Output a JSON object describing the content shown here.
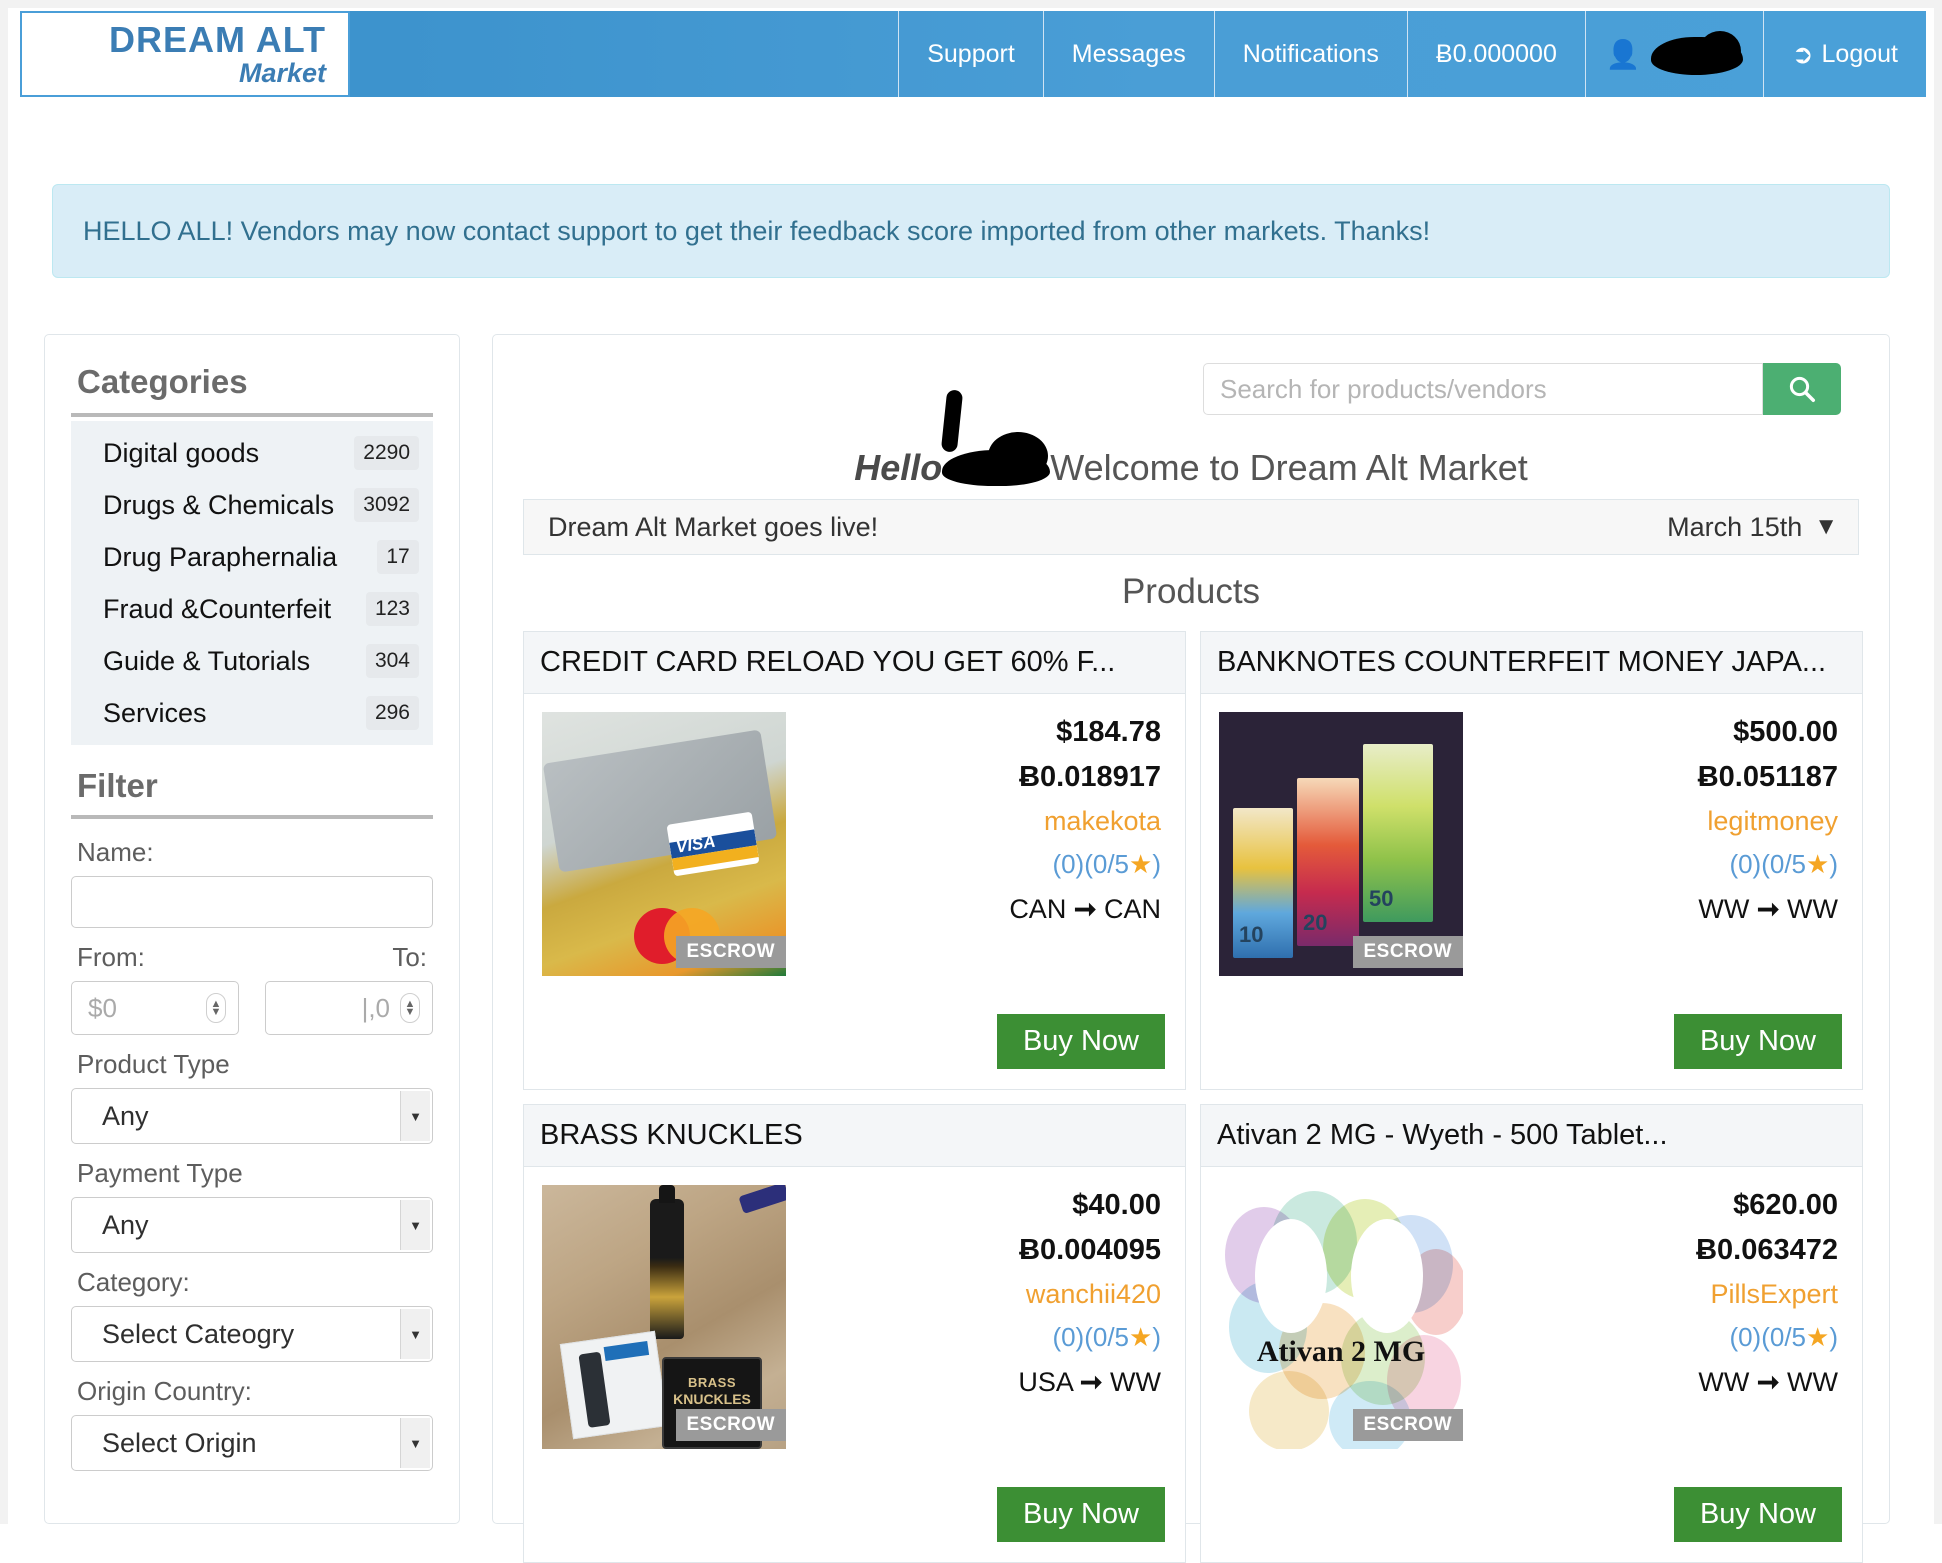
{
  "navbar": {
    "brand_line1": "DREAM ALT",
    "brand_line2": "Market",
    "items": [
      {
        "label": "Support"
      },
      {
        "label": "Messages"
      },
      {
        "label": "Notifications"
      },
      {
        "label": "Ƀ0.000000"
      }
    ],
    "username_redacted": "",
    "logout_label": "Logout"
  },
  "alert": {
    "message": "HELLO ALL! Vendors may now contact support to get their feedback score imported from other markets. Thanks!"
  },
  "sidebar": {
    "categories_title": "Categories",
    "categories": [
      {
        "name": "Digital goods",
        "count": "2290"
      },
      {
        "name": "Drugs & Chemicals",
        "count": "3092"
      },
      {
        "name": "Drug Paraphernalia",
        "count": "17"
      },
      {
        "name": "Fraud &Counterfeit",
        "count": "123"
      },
      {
        "name": "Guide & Tutorials",
        "count": "304"
      },
      {
        "name": "Services",
        "count": "296"
      }
    ],
    "filter_title": "Filter",
    "name_label": "Name:",
    "name_value": "",
    "from_label": "From:",
    "to_label": "To:",
    "from_placeholder": "$0",
    "to_placeholder": "|,0",
    "product_type_label": "Product Type",
    "product_type_value": "Any",
    "payment_type_label": "Payment Type",
    "payment_type_value": "Any",
    "category_label": "Category:",
    "category_value": "Select Cateogry",
    "origin_label": "Origin Country:",
    "origin_value": "Select Origin"
  },
  "main": {
    "search_placeholder": "Search for products/vendors",
    "search_value": "",
    "welcome_prefix": "Hello",
    "welcome_suffix": "Welcome to Dream Alt Market",
    "announcement_text": "Dream Alt Market goes live!",
    "announcement_date": "March 15th",
    "products_title": "Products",
    "buy_label": "Buy Now",
    "escrow_label": "ESCROW",
    "products": [
      {
        "title": "CREDIT CARD RELOAD YOU GET 60% F...",
        "price_usd": "$184.78",
        "price_btc": "Ƀ0.018917",
        "vendor": "makekota",
        "rating": "(0)(0/5",
        "rating_close": ")",
        "ship_from": "CAN",
        "ship_to": "CAN",
        "art": "credit-card"
      },
      {
        "title": "BANKNOTES COUNTERFEIT MONEY JAPA...",
        "price_usd": "$500.00",
        "price_btc": "Ƀ0.051187",
        "vendor": "legitmoney",
        "rating": "(0)(0/5",
        "rating_close": ")",
        "ship_from": "WW",
        "ship_to": "WW",
        "art": "banknotes"
      },
      {
        "title": "BRASS KNUCKLES",
        "price_usd": "$40.00",
        "price_btc": "Ƀ0.004095",
        "vendor": "wanchii420",
        "rating": "(0)(0/5",
        "rating_close": ")",
        "ship_from": "USA",
        "ship_to": "WW",
        "art": "brass-knuckles"
      },
      {
        "title": "Ativan 2 MG - Wyeth - 500 Tablet...",
        "price_usd": "$620.00",
        "price_btc": "Ƀ0.063472",
        "vendor": "PillsExpert",
        "rating": "(0)(0/5",
        "rating_close": ")",
        "ship_from": "WW",
        "ship_to": "WW",
        "art": "ativan",
        "art_label": "Ativan 2 MG"
      }
    ]
  },
  "colors": {
    "nav_blue": "#4a9ed6",
    "accent_green": "#3c8f34",
    "search_green": "#4caf72",
    "vendor_orange": "#f0a030",
    "rating_blue": "#5a9bd5",
    "star_orange": "#f5a623",
    "alert_bg": "#d9edf7",
    "alert_text": "#31708f"
  }
}
